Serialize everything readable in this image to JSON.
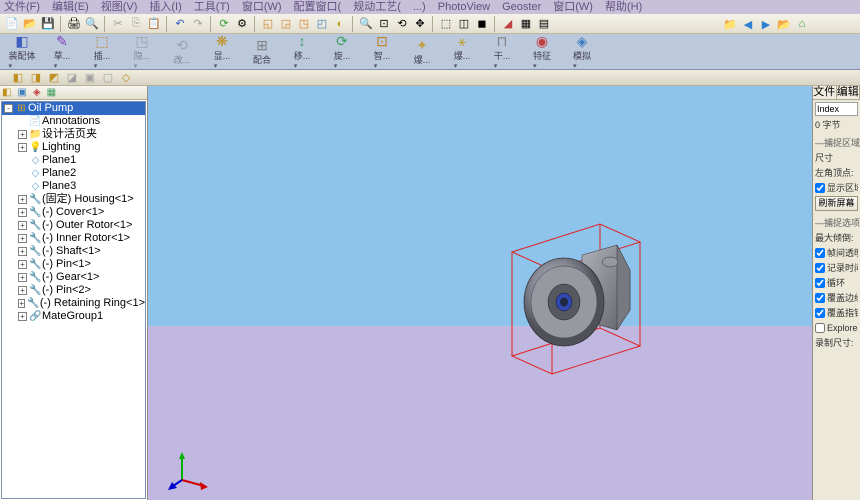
{
  "menus": [
    "文件(F)",
    "编辑(E)",
    "视图(V)",
    "插入(I)",
    "工具(T)",
    "窗口(W)",
    "配置窗口(",
    "规动工艺(",
    "...)",
    "PhotoView",
    "Geoster",
    "窗口(W)",
    "帮助(H)"
  ],
  "ribbon": [
    {
      "icon": "◧",
      "label": "装配体",
      "drop": true,
      "color": "#4060c0"
    },
    {
      "icon": "✎",
      "label": "草...",
      "drop": true,
      "color": "#8040c0"
    },
    {
      "icon": "⬚",
      "label": "插...",
      "drop": true,
      "color": "#c08020"
    },
    {
      "icon": "◳",
      "label": "隐...",
      "drop": true,
      "color": "#808080",
      "disabled": true
    },
    {
      "icon": "⟲",
      "label": "改...",
      "drop": false,
      "color": "#808080",
      "disabled": true
    },
    {
      "icon": "❋",
      "label": "显...",
      "drop": true,
      "color": "#c09020"
    },
    {
      "icon": "⊞",
      "label": "配合",
      "drop": false,
      "color": "#808080"
    },
    {
      "icon": "↕",
      "label": "移...",
      "drop": true,
      "color": "#40a060"
    },
    {
      "icon": "⟳",
      "label": "旋...",
      "drop": true,
      "color": "#40a060"
    },
    {
      "icon": "⊡",
      "label": "智...",
      "drop": true,
      "color": "#c08020"
    },
    {
      "icon": "✦",
      "label": "爆...",
      "drop": false,
      "color": "#c0a040"
    },
    {
      "icon": "⚹",
      "label": "爆...",
      "drop": true,
      "color": "#c0a040"
    },
    {
      "icon": "⊓",
      "label": "干...",
      "drop": true,
      "color": "#808080"
    },
    {
      "icon": "◉",
      "label": "特征",
      "drop": true,
      "color": "#c04040"
    },
    {
      "icon": "◈",
      "label": "模拟",
      "drop": true,
      "color": "#4080c0"
    }
  ],
  "tree_root": {
    "label": "Oil Pump",
    "expanded": true
  },
  "tree": [
    {
      "ico": "📄",
      "label": "Annotations",
      "exp": "none"
    },
    {
      "ico": "📁",
      "label": "设计活页夹",
      "exp": "+"
    },
    {
      "ico": "💡",
      "label": "Lighting",
      "exp": "+"
    },
    {
      "ico": "◇",
      "label": "Plane1",
      "exp": "none"
    },
    {
      "ico": "◇",
      "label": "Plane2",
      "exp": "none"
    },
    {
      "ico": "◇",
      "label": "Plane3",
      "exp": "none"
    },
    {
      "ico": "🔧",
      "label": "(固定) Housing<1>",
      "exp": "+"
    },
    {
      "ico": "🔧",
      "label": "(-) Cover<1>",
      "exp": "+"
    },
    {
      "ico": "🔧",
      "label": "(-) Outer Rotor<1>",
      "exp": "+"
    },
    {
      "ico": "🔧",
      "label": "(-) Inner Rotor<1>",
      "exp": "+"
    },
    {
      "ico": "🔧",
      "label": "(-) Shaft<1>",
      "exp": "+"
    },
    {
      "ico": "🔧",
      "label": "(-) Pin<1>",
      "exp": "+"
    },
    {
      "ico": "🔧",
      "label": "(-) Gear<1>",
      "exp": "+"
    },
    {
      "ico": "🔧",
      "label": "(-) Pin<2>",
      "exp": "+"
    },
    {
      "ico": "🔧",
      "label": "(-) Retaining Ring<1>",
      "exp": "+"
    },
    {
      "ico": "🔗",
      "label": "MateGroup1",
      "exp": "+"
    }
  ],
  "right": {
    "tabs": [
      "文件",
      "编辑"
    ],
    "input_val": "Index",
    "readout": "0  字节",
    "sections": {
      "s1": "—捕捉区域—",
      "s1a": "尺寸",
      "s1b": "左角顶点:",
      "chk1": "显示区域",
      "btn1": "刷新屏幕",
      "s2": "—捕捉选项—",
      "s2a": "最大倾倒:",
      "chk2": "帧间透明",
      "chk3": "记录时间",
      "chk4": "循环",
      "chk5": "覆盖边缘",
      "chk6": "覆盖指针",
      "chk7": "Explorer",
      "s3": "录制尺寸:"
    }
  }
}
